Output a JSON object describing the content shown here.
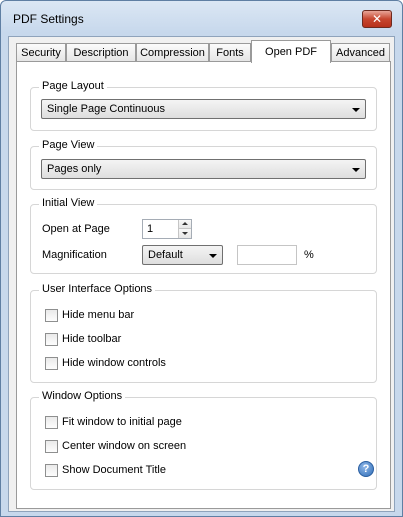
{
  "window": {
    "title": "PDF Settings",
    "close_glyph": "✕"
  },
  "tabs": [
    {
      "label": "Security",
      "active": false
    },
    {
      "label": "Description",
      "active": false
    },
    {
      "label": "Compression",
      "active": false
    },
    {
      "label": "Fonts",
      "active": false
    },
    {
      "label": "Open PDF",
      "active": true
    },
    {
      "label": "Advanced",
      "active": false
    }
  ],
  "page_layout": {
    "title": "Page Layout",
    "selected": "Single Page Continuous"
  },
  "page_view": {
    "title": "Page View",
    "selected": "Pages only"
  },
  "initial_view": {
    "title": "Initial View",
    "open_at_page_label": "Open at Page",
    "open_at_page_value": "1",
    "magnification_label": "Magnification",
    "magnification_selected": "Default",
    "magnification_custom_value": "",
    "percent_label": "%"
  },
  "ui_options": {
    "title": "User Interface Options",
    "items": [
      {
        "label": "Hide menu bar",
        "checked": false
      },
      {
        "label": "Hide toolbar",
        "checked": false
      },
      {
        "label": "Hide window controls",
        "checked": false
      }
    ]
  },
  "window_options": {
    "title": "Window Options",
    "items": [
      {
        "label": "Fit window to initial page",
        "checked": false
      },
      {
        "label": "Center window on screen",
        "checked": false
      },
      {
        "label": "Show Document Title",
        "checked": false
      }
    ]
  },
  "help": {
    "glyph": "?"
  }
}
